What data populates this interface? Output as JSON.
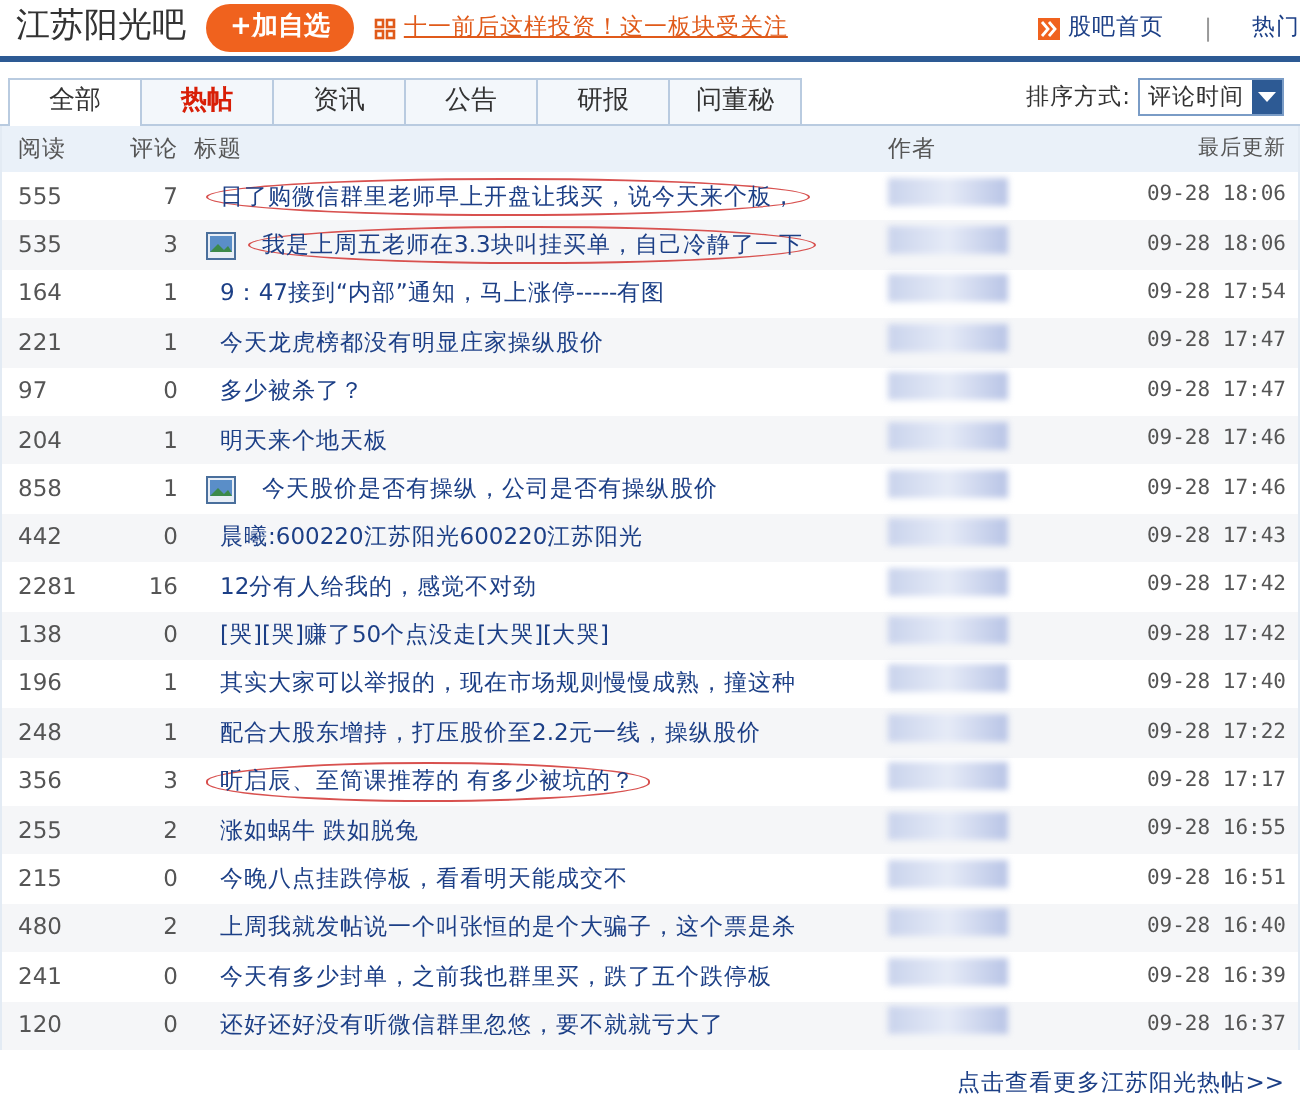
{
  "header": {
    "forum_name": "江苏阳光吧",
    "add_button": "+加自选",
    "promo_text": "十一前后这样投资！这一板块受关注",
    "home_link": "股吧首页",
    "separator": "|",
    "hot_link": "热门"
  },
  "tabs": [
    {
      "label": "全部",
      "selected": true,
      "hot": false
    },
    {
      "label": "热帖",
      "selected": false,
      "hot": true
    },
    {
      "label": "资讯",
      "selected": false,
      "hot": false
    },
    {
      "label": "公告",
      "selected": false,
      "hot": false
    },
    {
      "label": "研报",
      "selected": false,
      "hot": false
    },
    {
      "label": "问董秘",
      "selected": false,
      "hot": false
    }
  ],
  "sort": {
    "label": "排序方式:",
    "value": "评论时间"
  },
  "table": {
    "columns": [
      "阅读",
      "评论",
      "标题",
      "作者",
      "最后更新"
    ],
    "rows": [
      {
        "reads": "555",
        "comments": "7",
        "title": "日了购微信群里老师早上开盘让我买，说今天来个板，",
        "has_image": false,
        "circled": true,
        "time": "09-28 18:06"
      },
      {
        "reads": "535",
        "comments": "3",
        "title": "我是上周五老师在3.3块叫挂买单，自己冷静了一下",
        "has_image": true,
        "circled": true,
        "time": "09-28 18:06"
      },
      {
        "reads": "164",
        "comments": "1",
        "title": "9：47接到“内部”通知，马上涨停-----有图",
        "has_image": false,
        "circled": false,
        "time": "09-28 17:54"
      },
      {
        "reads": "221",
        "comments": "1",
        "title": "今天龙虎榜都没有明显庄家操纵股价",
        "has_image": false,
        "circled": false,
        "time": "09-28 17:47"
      },
      {
        "reads": "97",
        "comments": "0",
        "title": "多少被杀了？",
        "has_image": false,
        "circled": false,
        "time": "09-28 17:47"
      },
      {
        "reads": "204",
        "comments": "1",
        "title": "明天来个地天板",
        "has_image": false,
        "circled": false,
        "time": "09-28 17:46"
      },
      {
        "reads": "858",
        "comments": "1",
        "title": "今天股价是否有操纵，公司是否有操纵股价",
        "has_image": true,
        "circled": false,
        "time": "09-28 17:46"
      },
      {
        "reads": "442",
        "comments": "0",
        "title": "晨曦:600220江苏阳光600220江苏阳光",
        "has_image": false,
        "circled": false,
        "time": "09-28 17:43"
      },
      {
        "reads": "2281",
        "comments": "16",
        "title": "12分有人给我的，感觉不对劲",
        "has_image": false,
        "circled": false,
        "time": "09-28 17:42"
      },
      {
        "reads": "138",
        "comments": "0",
        "title": "[哭][哭]赚了50个点没走[大哭][大哭]",
        "has_image": false,
        "circled": false,
        "time": "09-28 17:42"
      },
      {
        "reads": "196",
        "comments": "1",
        "title": "其实大家可以举报的，现在市场规则慢慢成熟，撞这种",
        "has_image": false,
        "circled": false,
        "time": "09-28 17:40"
      },
      {
        "reads": "248",
        "comments": "1",
        "title": "配合大股东增持，打压股价至2.2元一线，操纵股价",
        "has_image": false,
        "circled": false,
        "time": "09-28 17:22"
      },
      {
        "reads": "356",
        "comments": "3",
        "title": "听启辰、至简课推荐的 有多少被坑的？",
        "has_image": false,
        "circled": true,
        "time": "09-28 17:17"
      },
      {
        "reads": "255",
        "comments": "2",
        "title": "涨如蜗牛 跌如脱兔",
        "has_image": false,
        "circled": false,
        "time": "09-28 16:55"
      },
      {
        "reads": "215",
        "comments": "0",
        "title": "今晚八点挂跌停板，看看明天能成交不",
        "has_image": false,
        "circled": false,
        "time": "09-28 16:51"
      },
      {
        "reads": "480",
        "comments": "2",
        "title": "上周我就发帖说一个叫张恒的是个大骗子，这个票是杀",
        "has_image": false,
        "circled": false,
        "time": "09-28 16:40"
      },
      {
        "reads": "241",
        "comments": "0",
        "title": "今天有多少封单，之前我也群里买，跌了五个跌停板",
        "has_image": false,
        "circled": false,
        "time": "09-28 16:39"
      },
      {
        "reads": "120",
        "comments": "0",
        "title": "还好还好没有听微信群里忽悠，要不就就亏大了",
        "has_image": false,
        "circled": false,
        "time": "09-28 16:37"
      }
    ]
  },
  "more_link": "点击查看更多江苏阳光热帖>>"
}
